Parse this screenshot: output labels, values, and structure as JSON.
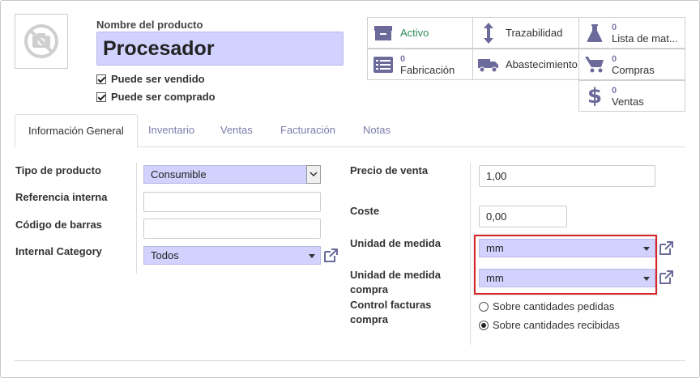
{
  "product": {
    "name_label": "Nombre del producto",
    "name_value": "Procesador",
    "can_be_sold_label": "Puede ser vendido",
    "can_be_purchased_label": "Puede ser comprado"
  },
  "smart_buttons": {
    "active": {
      "label": "Activo",
      "color": "#2e8b57"
    },
    "traceability": {
      "label": "Trazabilidad"
    },
    "bom": {
      "count": "0",
      "label": "Lista de mat..."
    },
    "manufacturing": {
      "count": "0",
      "label": "Fabricación"
    },
    "supply": {
      "label": "Abastecimiento"
    },
    "purchases": {
      "count": "0",
      "label": "Compras"
    },
    "sales": {
      "count": "0",
      "label": "Ventas"
    }
  },
  "tabs": [
    {
      "label": "Información General",
      "active": true
    },
    {
      "label": "Inventario",
      "active": false
    },
    {
      "label": "Ventas",
      "active": false
    },
    {
      "label": "Facturación",
      "active": false
    },
    {
      "label": "Notas",
      "active": false
    }
  ],
  "general": {
    "product_type_label": "Tipo de producto",
    "product_type_value": "Consumible",
    "internal_ref_label": "Referencia interna",
    "internal_ref_value": "",
    "barcode_label": "Código de barras",
    "barcode_value": "",
    "category_label": "Internal Category",
    "category_value": "Todos",
    "sale_price_label": "Precio de venta",
    "sale_price_value": "1,00",
    "cost_label": "Coste",
    "cost_value": "0,00",
    "uom_label": "Unidad de medida",
    "uom_value": "mm",
    "uom_po_label_line1": "Unidad de medida",
    "uom_po_label_line2": "compra",
    "uom_po_value": "mm",
    "purchase_control_label_line1": "Control facturas",
    "purchase_control_label_line2": "compra",
    "purchase_control_options": [
      {
        "label": "Sobre cantidades pedidas",
        "selected": false
      },
      {
        "label": "Sobre cantidades recibidas",
        "selected": true
      }
    ]
  },
  "colors": {
    "accent": "#7c7bad",
    "required_field": "#d2d2ff",
    "highlight_box": "#d9262b"
  }
}
